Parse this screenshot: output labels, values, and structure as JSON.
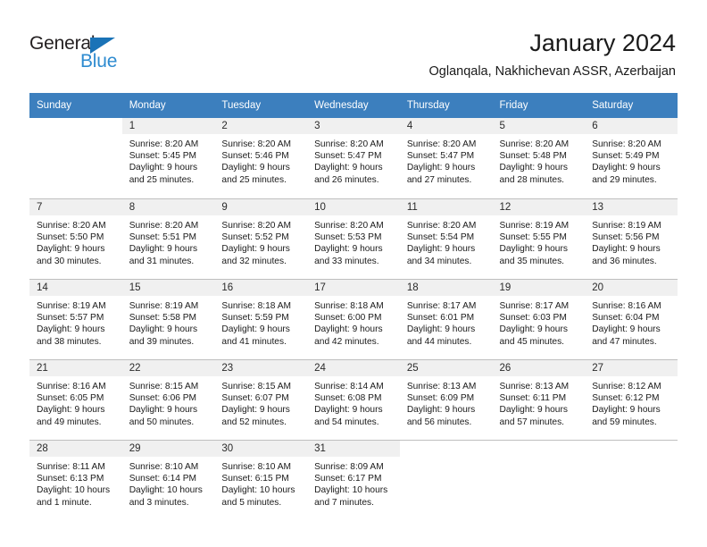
{
  "brand": {
    "name_dark": "General",
    "name_light": "Blue"
  },
  "header": {
    "title": "January 2024",
    "subtitle": "Oglanqala, Nakhichevan ASSR, Azerbaijan"
  },
  "colors": {
    "header_blue": "#3c7fbe",
    "daynum_strip": "#f0f0f0",
    "logo_blue": "#2e8bd0",
    "grid_line": "#bfbfbf"
  },
  "weekday_headers": [
    "Sunday",
    "Monday",
    "Tuesday",
    "Wednesday",
    "Thursday",
    "Friday",
    "Saturday"
  ],
  "weeks": [
    [
      {
        "day": "",
        "blank": true
      },
      {
        "day": "1",
        "sunrise": "Sunrise: 8:20 AM",
        "sunset": "Sunset: 5:45 PM",
        "daylight1": "Daylight: 9 hours",
        "daylight2": "and 25 minutes."
      },
      {
        "day": "2",
        "sunrise": "Sunrise: 8:20 AM",
        "sunset": "Sunset: 5:46 PM",
        "daylight1": "Daylight: 9 hours",
        "daylight2": "and 25 minutes."
      },
      {
        "day": "3",
        "sunrise": "Sunrise: 8:20 AM",
        "sunset": "Sunset: 5:47 PM",
        "daylight1": "Daylight: 9 hours",
        "daylight2": "and 26 minutes."
      },
      {
        "day": "4",
        "sunrise": "Sunrise: 8:20 AM",
        "sunset": "Sunset: 5:47 PM",
        "daylight1": "Daylight: 9 hours",
        "daylight2": "and 27 minutes."
      },
      {
        "day": "5",
        "sunrise": "Sunrise: 8:20 AM",
        "sunset": "Sunset: 5:48 PM",
        "daylight1": "Daylight: 9 hours",
        "daylight2": "and 28 minutes."
      },
      {
        "day": "6",
        "sunrise": "Sunrise: 8:20 AM",
        "sunset": "Sunset: 5:49 PM",
        "daylight1": "Daylight: 9 hours",
        "daylight2": "and 29 minutes."
      }
    ],
    [
      {
        "day": "7",
        "sunrise": "Sunrise: 8:20 AM",
        "sunset": "Sunset: 5:50 PM",
        "daylight1": "Daylight: 9 hours",
        "daylight2": "and 30 minutes."
      },
      {
        "day": "8",
        "sunrise": "Sunrise: 8:20 AM",
        "sunset": "Sunset: 5:51 PM",
        "daylight1": "Daylight: 9 hours",
        "daylight2": "and 31 minutes."
      },
      {
        "day": "9",
        "sunrise": "Sunrise: 8:20 AM",
        "sunset": "Sunset: 5:52 PM",
        "daylight1": "Daylight: 9 hours",
        "daylight2": "and 32 minutes."
      },
      {
        "day": "10",
        "sunrise": "Sunrise: 8:20 AM",
        "sunset": "Sunset: 5:53 PM",
        "daylight1": "Daylight: 9 hours",
        "daylight2": "and 33 minutes."
      },
      {
        "day": "11",
        "sunrise": "Sunrise: 8:20 AM",
        "sunset": "Sunset: 5:54 PM",
        "daylight1": "Daylight: 9 hours",
        "daylight2": "and 34 minutes."
      },
      {
        "day": "12",
        "sunrise": "Sunrise: 8:19 AM",
        "sunset": "Sunset: 5:55 PM",
        "daylight1": "Daylight: 9 hours",
        "daylight2": "and 35 minutes."
      },
      {
        "day": "13",
        "sunrise": "Sunrise: 8:19 AM",
        "sunset": "Sunset: 5:56 PM",
        "daylight1": "Daylight: 9 hours",
        "daylight2": "and 36 minutes."
      }
    ],
    [
      {
        "day": "14",
        "sunrise": "Sunrise: 8:19 AM",
        "sunset": "Sunset: 5:57 PM",
        "daylight1": "Daylight: 9 hours",
        "daylight2": "and 38 minutes."
      },
      {
        "day": "15",
        "sunrise": "Sunrise: 8:19 AM",
        "sunset": "Sunset: 5:58 PM",
        "daylight1": "Daylight: 9 hours",
        "daylight2": "and 39 minutes."
      },
      {
        "day": "16",
        "sunrise": "Sunrise: 8:18 AM",
        "sunset": "Sunset: 5:59 PM",
        "daylight1": "Daylight: 9 hours",
        "daylight2": "and 41 minutes."
      },
      {
        "day": "17",
        "sunrise": "Sunrise: 8:18 AM",
        "sunset": "Sunset: 6:00 PM",
        "daylight1": "Daylight: 9 hours",
        "daylight2": "and 42 minutes."
      },
      {
        "day": "18",
        "sunrise": "Sunrise: 8:17 AM",
        "sunset": "Sunset: 6:01 PM",
        "daylight1": "Daylight: 9 hours",
        "daylight2": "and 44 minutes."
      },
      {
        "day": "19",
        "sunrise": "Sunrise: 8:17 AM",
        "sunset": "Sunset: 6:03 PM",
        "daylight1": "Daylight: 9 hours",
        "daylight2": "and 45 minutes."
      },
      {
        "day": "20",
        "sunrise": "Sunrise: 8:16 AM",
        "sunset": "Sunset: 6:04 PM",
        "daylight1": "Daylight: 9 hours",
        "daylight2": "and 47 minutes."
      }
    ],
    [
      {
        "day": "21",
        "sunrise": "Sunrise: 8:16 AM",
        "sunset": "Sunset: 6:05 PM",
        "daylight1": "Daylight: 9 hours",
        "daylight2": "and 49 minutes."
      },
      {
        "day": "22",
        "sunrise": "Sunrise: 8:15 AM",
        "sunset": "Sunset: 6:06 PM",
        "daylight1": "Daylight: 9 hours",
        "daylight2": "and 50 minutes."
      },
      {
        "day": "23",
        "sunrise": "Sunrise: 8:15 AM",
        "sunset": "Sunset: 6:07 PM",
        "daylight1": "Daylight: 9 hours",
        "daylight2": "and 52 minutes."
      },
      {
        "day": "24",
        "sunrise": "Sunrise: 8:14 AM",
        "sunset": "Sunset: 6:08 PM",
        "daylight1": "Daylight: 9 hours",
        "daylight2": "and 54 minutes."
      },
      {
        "day": "25",
        "sunrise": "Sunrise: 8:13 AM",
        "sunset": "Sunset: 6:09 PM",
        "daylight1": "Daylight: 9 hours",
        "daylight2": "and 56 minutes."
      },
      {
        "day": "26",
        "sunrise": "Sunrise: 8:13 AM",
        "sunset": "Sunset: 6:11 PM",
        "daylight1": "Daylight: 9 hours",
        "daylight2": "and 57 minutes."
      },
      {
        "day": "27",
        "sunrise": "Sunrise: 8:12 AM",
        "sunset": "Sunset: 6:12 PM",
        "daylight1": "Daylight: 9 hours",
        "daylight2": "and 59 minutes."
      }
    ],
    [
      {
        "day": "28",
        "sunrise": "Sunrise: 8:11 AM",
        "sunset": "Sunset: 6:13 PM",
        "daylight1": "Daylight: 10 hours",
        "daylight2": "and 1 minute."
      },
      {
        "day": "29",
        "sunrise": "Sunrise: 8:10 AM",
        "sunset": "Sunset: 6:14 PM",
        "daylight1": "Daylight: 10 hours",
        "daylight2": "and 3 minutes."
      },
      {
        "day": "30",
        "sunrise": "Sunrise: 8:10 AM",
        "sunset": "Sunset: 6:15 PM",
        "daylight1": "Daylight: 10 hours",
        "daylight2": "and 5 minutes."
      },
      {
        "day": "31",
        "sunrise": "Sunrise: 8:09 AM",
        "sunset": "Sunset: 6:17 PM",
        "daylight1": "Daylight: 10 hours",
        "daylight2": "and 7 minutes."
      },
      {
        "day": "",
        "blank": true
      },
      {
        "day": "",
        "blank": true
      },
      {
        "day": "",
        "blank": true
      }
    ]
  ]
}
